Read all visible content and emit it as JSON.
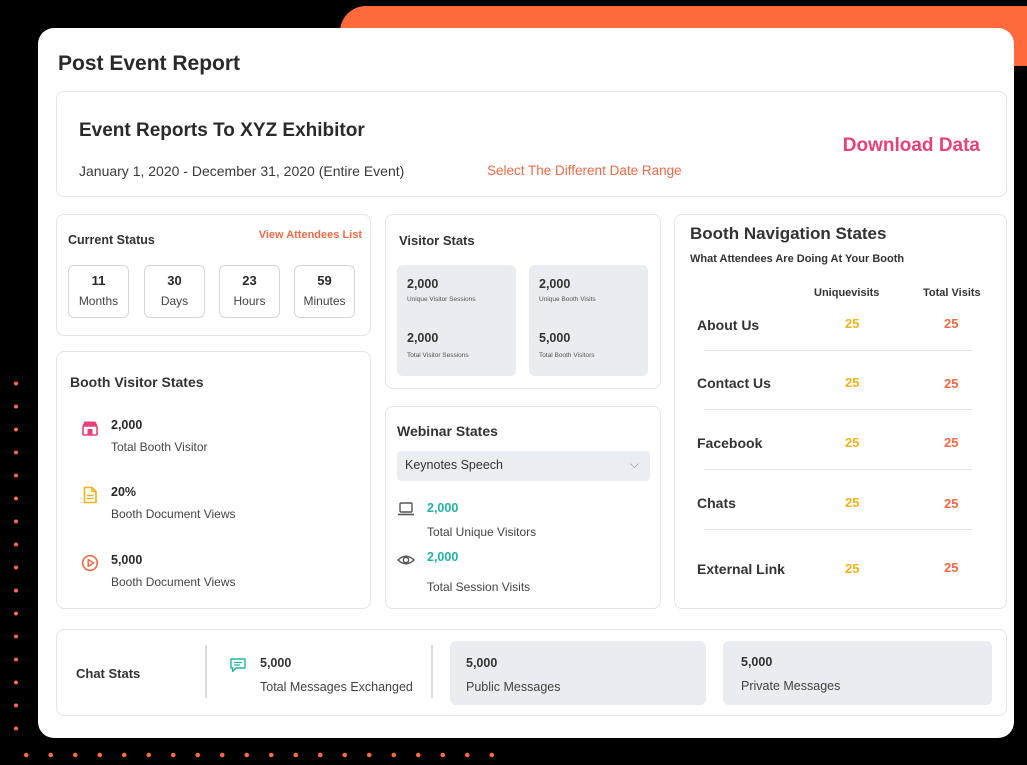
{
  "page_title": "Post Event Report",
  "header": {
    "title": "Event Reports To XYZ Exhibitor",
    "date_range": "January 1, 2020 - December 31, 2020 (Entire Event)",
    "date_link": "Select The Different Date Range",
    "download": "Download Data"
  },
  "current_status": {
    "title": "Current Status",
    "link": "View Attendees List",
    "items": [
      {
        "value": "11",
        "label": "Months"
      },
      {
        "value": "30",
        "label": "Days"
      },
      {
        "value": "23",
        "label": "Hours"
      },
      {
        "value": "59",
        "label": "Minutes"
      }
    ]
  },
  "booth_visitor": {
    "title": "Booth Visitor States",
    "items": [
      {
        "value": "2,000",
        "label": "Total Booth Visitor",
        "icon": "store-icon"
      },
      {
        "value": "20%",
        "label": "Booth Document Views",
        "icon": "document-icon"
      },
      {
        "value": "5,000",
        "label": "Booth Document Views",
        "icon": "play-icon"
      }
    ]
  },
  "visitor_stats": {
    "title": "Visitor Stats",
    "items": [
      {
        "value": "2,000",
        "label": "Unique Visitor Sessions"
      },
      {
        "value": "2,000",
        "label": "Unique Booth Visits"
      },
      {
        "value": "2,000",
        "label": "Total Visitor Sessions"
      },
      {
        "value": "5,000",
        "label": "Total Booth Visitors"
      }
    ]
  },
  "webinar": {
    "title": "Webinar States",
    "selected": "Keynotes Speech",
    "items": [
      {
        "value": "2,000",
        "label": "Total Unique Visitors",
        "icon": "laptop-icon"
      },
      {
        "value": "2,000",
        "label": "Total Session Visits",
        "icon": "eye-icon"
      }
    ]
  },
  "booth_nav": {
    "title": "Booth Navigation States",
    "subtitle": "What Attendees Are Doing At Your Booth",
    "col_unique": "Uniquevisits",
    "col_total": "Total Visits",
    "rows": [
      {
        "name": "About Us",
        "unique": "25",
        "total": "25"
      },
      {
        "name": "Contact Us",
        "unique": "25",
        "total": "25"
      },
      {
        "name": "Facebook",
        "unique": "25",
        "total": "25"
      },
      {
        "name": "Chats",
        "unique": "25",
        "total": "25"
      },
      {
        "name": "External Link",
        "unique": "25",
        "total": "25"
      }
    ]
  },
  "chat_stats": {
    "title": "Chat Stats",
    "items": [
      {
        "value": "5,000",
        "label": "Total Messages Exchanged",
        "icon": "message-icon"
      },
      {
        "value": "5,000",
        "label": "Public Messages"
      },
      {
        "value": "5,000",
        "label": "Private Messages"
      }
    ]
  },
  "colors": {
    "accent_orange": "#f26a45",
    "accent_pink": "#e8407a",
    "accent_yellow": "#f2b21c",
    "accent_teal": "#1fb5a6"
  }
}
